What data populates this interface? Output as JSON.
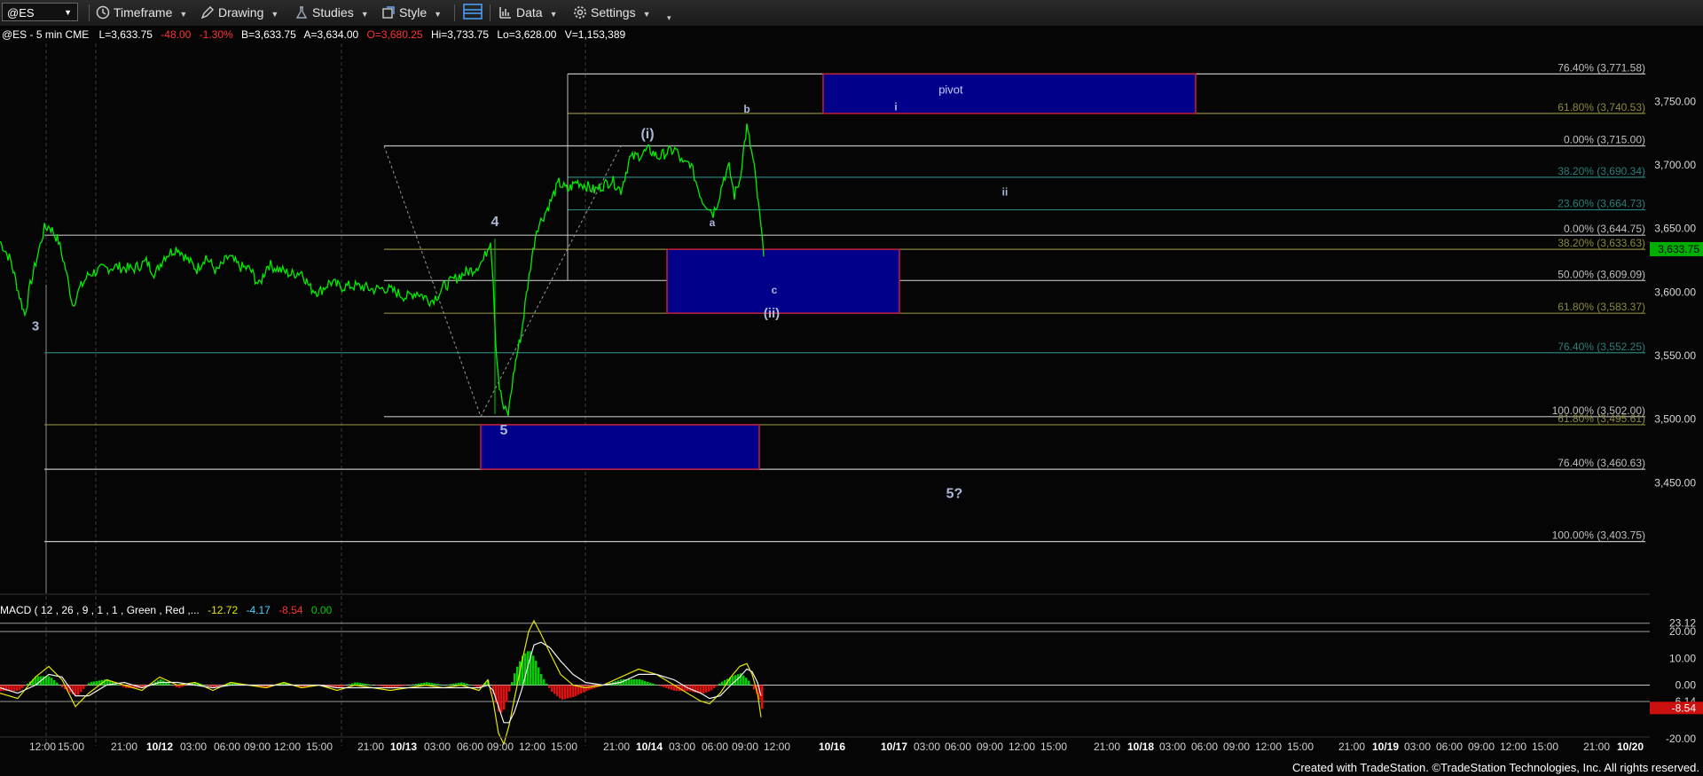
{
  "toolbar": {
    "symbol": "@ES",
    "timeframe": "Timeframe",
    "drawing": "Drawing",
    "studies": "Studies",
    "style": "Style",
    "data": "Data",
    "settings": "Settings"
  },
  "footer": {
    "credit": "Created with TradeStation. ©TradeStation Technologies, Inc. All rights reserved."
  },
  "colors": {
    "price": "#00ee00",
    "box_fill": "#00008b",
    "box_border": "#c0203a",
    "fib_white": "#bfbfbf",
    "fib_olive": "#8c8a3c",
    "fib_teal": "#2a7f7a",
    "label": "#aab8d8"
  },
  "chart_data": {
    "type": "line",
    "header": {
      "symbol_desc": "@ES - 5 min  CME",
      "L": "L=3,633.75",
      "chg": "-48.00",
      "pct": "-1.30%",
      "B": "B=3,633.75",
      "A": "A=3,634.00",
      "O": "O=3,680.25",
      "Hi": "Hi=3,733.75",
      "Lo": "Lo=3,628.00",
      "V": "V=1,153,389"
    },
    "ylim": [
      3370,
      3790
    ],
    "y_ticks": [
      "3,750.00",
      "3,700.00",
      "3,650.00",
      "3,600.00",
      "3,550.00",
      "3,500.00",
      "3,450.00"
    ],
    "y_tick_values": [
      3750,
      3700,
      3650,
      3600,
      3550,
      3500,
      3450
    ],
    "last_price": "3,633.75",
    "x_range": [
      0,
      1860
    ],
    "x_ticks": [
      {
        "t": 48,
        "label": "12:00"
      },
      {
        "t": 80,
        "label": "15:00"
      },
      {
        "t": 140,
        "label": "21:00"
      },
      {
        "t": 180,
        "label": "10/12",
        "bold": true
      },
      {
        "t": 218,
        "label": "03:00"
      },
      {
        "t": 256,
        "label": "06:00"
      },
      {
        "t": 290,
        "label": "09:00"
      },
      {
        "t": 324,
        "label": "12:00"
      },
      {
        "t": 360,
        "label": "15:00"
      },
      {
        "t": 418,
        "label": "21:00"
      },
      {
        "t": 455,
        "label": "10/13",
        "bold": true
      },
      {
        "t": 493,
        "label": "03:00"
      },
      {
        "t": 530,
        "label": "06:00"
      },
      {
        "t": 564,
        "label": "09:00"
      },
      {
        "t": 600,
        "label": "12:00"
      },
      {
        "t": 636,
        "label": "15:00"
      },
      {
        "t": 695,
        "label": "21:00"
      },
      {
        "t": 732,
        "label": "10/14",
        "bold": true
      },
      {
        "t": 769,
        "label": "03:00"
      },
      {
        "t": 806,
        "label": "06:00"
      },
      {
        "t": 840,
        "label": "09:00"
      },
      {
        "t": 876,
        "label": "12:00"
      },
      {
        "t": 938,
        "label": "10/16",
        "bold": true
      },
      {
        "t": 1008,
        "label": "10/17",
        "bold": true
      },
      {
        "t": 1045,
        "label": "03:00"
      },
      {
        "t": 1080,
        "label": "06:00"
      },
      {
        "t": 1116,
        "label": "09:00"
      },
      {
        "t": 1152,
        "label": "12:00"
      },
      {
        "t": 1188,
        "label": "15:00"
      },
      {
        "t": 1248,
        "label": "21:00"
      },
      {
        "t": 1286,
        "label": "10/18",
        "bold": true
      },
      {
        "t": 1322,
        "label": "03:00"
      },
      {
        "t": 1358,
        "label": "06:00"
      },
      {
        "t": 1394,
        "label": "09:00"
      },
      {
        "t": 1430,
        "label": "12:00"
      },
      {
        "t": 1466,
        "label": "15:00"
      },
      {
        "t": 1524,
        "label": "21:00"
      },
      {
        "t": 1562,
        "label": "10/19",
        "bold": true
      },
      {
        "t": 1598,
        "label": "03:00"
      },
      {
        "t": 1634,
        "label": "06:00"
      },
      {
        "t": 1670,
        "label": "09:00"
      },
      {
        "t": 1706,
        "label": "12:00"
      },
      {
        "t": 1742,
        "label": "15:00"
      },
      {
        "t": 1800,
        "label": "21:00"
      },
      {
        "t": 1838,
        "label": "10/20",
        "bold": true
      }
    ],
    "session_lines": [
      52,
      108,
      385,
      660
    ],
    "price_anchors": [
      [
        0,
        3640
      ],
      [
        12,
        3625
      ],
      [
        22,
        3597
      ],
      [
        28,
        3582
      ],
      [
        34,
        3605
      ],
      [
        42,
        3628
      ],
      [
        50,
        3650
      ],
      [
        56,
        3652
      ],
      [
        66,
        3640
      ],
      [
        74,
        3618
      ],
      [
        82,
        3590
      ],
      [
        90,
        3603
      ],
      [
        100,
        3614
      ],
      [
        115,
        3618
      ],
      [
        130,
        3620
      ],
      [
        150,
        3618
      ],
      [
        165,
        3624
      ],
      [
        175,
        3614
      ],
      [
        185,
        3628
      ],
      [
        200,
        3635
      ],
      [
        212,
        3625
      ],
      [
        222,
        3618
      ],
      [
        232,
        3628
      ],
      [
        244,
        3616
      ],
      [
        258,
        3628
      ],
      [
        270,
        3620
      ],
      [
        282,
        3618
      ],
      [
        292,
        3605
      ],
      [
        302,
        3622
      ],
      [
        314,
        3618
      ],
      [
        328,
        3614
      ],
      [
        340,
        3616
      ],
      [
        350,
        3603
      ],
      [
        360,
        3600
      ],
      [
        372,
        3608
      ],
      [
        384,
        3604
      ],
      [
        396,
        3605
      ],
      [
        410,
        3604
      ],
      [
        420,
        3602
      ],
      [
        434,
        3603
      ],
      [
        446,
        3600
      ],
      [
        458,
        3596
      ],
      [
        470,
        3600
      ],
      [
        486,
        3593
      ],
      [
        494,
        3598
      ],
      [
        500,
        3604
      ],
      [
        512,
        3610
      ],
      [
        524,
        3615
      ],
      [
        534,
        3618
      ],
      [
        545,
        3625
      ],
      [
        550,
        3635
      ],
      [
        553,
        3642
      ],
      [
        556,
        3610
      ],
      [
        559,
        3560
      ],
      [
        563,
        3525
      ],
      [
        568,
        3508
      ],
      [
        573,
        3504
      ],
      [
        576,
        3520
      ],
      [
        580,
        3540
      ],
      [
        584,
        3555
      ],
      [
        588,
        3568
      ],
      [
        592,
        3590
      ],
      [
        598,
        3620
      ],
      [
        605,
        3650
      ],
      [
        613,
        3660
      ],
      [
        620,
        3670
      ],
      [
        630,
        3686
      ],
      [
        640,
        3680
      ],
      [
        650,
        3687
      ],
      [
        660,
        3684
      ],
      [
        670,
        3680
      ],
      [
        680,
        3684
      ],
      [
        690,
        3688
      ],
      [
        700,
        3680
      ],
      [
        710,
        3705
      ],
      [
        722,
        3708
      ],
      [
        732,
        3712
      ],
      [
        742,
        3706
      ],
      [
        752,
        3710
      ],
      [
        762,
        3712
      ],
      [
        770,
        3700
      ],
      [
        778,
        3702
      ],
      [
        786,
        3684
      ],
      [
        792,
        3672
      ],
      [
        798,
        3668
      ],
      [
        804,
        3662
      ],
      [
        810,
        3673
      ],
      [
        816,
        3690
      ],
      [
        822,
        3698
      ],
      [
        828,
        3676
      ],
      [
        834,
        3688
      ],
      [
        838,
        3710
      ],
      [
        842,
        3730
      ],
      [
        846,
        3715
      ],
      [
        850,
        3700
      ],
      [
        854,
        3675
      ],
      [
        858,
        3650
      ],
      [
        861,
        3628
      ]
    ],
    "fib_levels": [
      {
        "price": 3771.58,
        "label": "76.40% (3,771.58)",
        "x0": 640,
        "x1": 1855,
        "color": "white"
      },
      {
        "price": 3740.53,
        "label": "61.80% (3,740.53)",
        "x0": 640,
        "x1": 1855,
        "color": "olive"
      },
      {
        "price": 3715.0,
        "label": "0.00% (3,715.00)",
        "x0": 433,
        "x1": 1855,
        "color": "white"
      },
      {
        "price": 3690.34,
        "label": "38.20% (3,690.34)",
        "x0": 640,
        "x1": 1855,
        "color": "teal"
      },
      {
        "price": 3664.73,
        "label": "23.60% (3,664.73)",
        "x0": 640,
        "x1": 1855,
        "color": "teal"
      },
      {
        "price": 3644.75,
        "label": "0.00% (3,644.75)",
        "x0": 50,
        "x1": 1855,
        "color": "white"
      },
      {
        "price": 3633.63,
        "label": "38.20% (3,633.63)",
        "x0": 433,
        "x1": 1855,
        "color": "olive"
      },
      {
        "price": 3609.09,
        "label": "50.00% (3,609.09)",
        "x0": 433,
        "x1": 1855,
        "color": "white"
      },
      {
        "price": 3583.37,
        "label": "61.80% (3,583.37)",
        "x0": 433,
        "x1": 1855,
        "color": "olive"
      },
      {
        "price": 3552.25,
        "label": "76.40% (3,552.25)",
        "x0": 50,
        "x1": 1855,
        "color": "teal"
      },
      {
        "price": 3502.0,
        "label": "100.00% (3,502.00)",
        "x0": 433,
        "x1": 1855,
        "color": "white"
      },
      {
        "price": 3495.61,
        "label": "61.80% (3,495.61)",
        "x0": 50,
        "x1": 1855,
        "color": "olive"
      },
      {
        "price": 3460.63,
        "label": "76.40% (3,460.63)",
        "x0": 50,
        "x1": 1855,
        "color": "white"
      },
      {
        "price": 3403.75,
        "label": "100.00% (3,403.75)",
        "x0": 50,
        "x1": 1855,
        "color": "white"
      }
    ],
    "boxes": [
      {
        "name": "pivot-box",
        "x0": 928,
        "x1": 1348,
        "p_top": 3771.58,
        "p_bot": 3740.53,
        "label": "pivot"
      },
      {
        "name": "wave-ii-target-box",
        "x0": 752,
        "x1": 1014,
        "p_top": 3633.63,
        "p_bot": 3583.37,
        "label": ""
      },
      {
        "name": "wave-5-target-box",
        "x0": 542,
        "x1": 856,
        "p_top": 3495.61,
        "p_bot": 3460.63,
        "label": ""
      }
    ],
    "wave_labels": [
      {
        "text": "3",
        "t": 40,
        "p": 3570,
        "size": 15
      },
      {
        "text": "4",
        "t": 558,
        "p": 3652,
        "size": 16
      },
      {
        "text": "5",
        "t": 568,
        "p": 3488,
        "size": 16
      },
      {
        "text": "(i)",
        "t": 730,
        "p": 3721,
        "size": 16
      },
      {
        "text": "a",
        "t": 803,
        "p": 3652,
        "size": 12
      },
      {
        "text": "b",
        "t": 842,
        "p": 3741,
        "size": 12
      },
      {
        "text": "c",
        "t": 873,
        "p": 3599,
        "size": 12
      },
      {
        "text": "(ii)",
        "t": 870,
        "p": 3580,
        "size": 15
      },
      {
        "text": "i",
        "t": 1010,
        "p": 3743,
        "size": 12
      },
      {
        "text": "ii",
        "t": 1133,
        "p": 3676,
        "size": 12
      },
      {
        "text": "5?",
        "t": 1076,
        "p": 3438,
        "size": 16
      }
    ],
    "trendlines": [
      {
        "t0": 433,
        "p0": 3715.0,
        "t1": 542,
        "p1": 3502.0
      },
      {
        "t0": 542,
        "p0": 3502.0,
        "t1": 700,
        "p1": 3715.0
      }
    ],
    "macd": {
      "title": "MACD ( 12 , 26 , 9 , 1 , 1 , Green , Red ,...",
      "values_text": [
        "-12.72",
        "-4.17",
        "-8.54",
        "0.00"
      ],
      "value_colors": [
        "#e6e600",
        "#4fd0ff",
        "#ff3030",
        "#00cc00"
      ],
      "ylim": [
        -26,
        26
      ],
      "y_ticks": [
        {
          "v": 23.12,
          "label": "23.12"
        },
        {
          "v": 20,
          "label": "20.00"
        },
        {
          "v": 10,
          "label": "10.00"
        },
        {
          "v": 0,
          "label": "0.00"
        },
        {
          "v": -6.14,
          "label": "-6.14"
        },
        {
          "v": -8.54,
          "label": "-8.54"
        },
        {
          "v": -20,
          "label": "-20.00"
        }
      ],
      "h_lines": [
        23.12,
        20,
        0,
        -6.14
      ],
      "line1": [
        [
          0,
          -3
        ],
        [
          20,
          -5
        ],
        [
          40,
          3
        ],
        [
          55,
          7
        ],
        [
          70,
          2
        ],
        [
          85,
          -8
        ],
        [
          100,
          -3
        ],
        [
          120,
          2
        ],
        [
          140,
          0
        ],
        [
          160,
          -2
        ],
        [
          180,
          3
        ],
        [
          200,
          0
        ],
        [
          220,
          1
        ],
        [
          240,
          -2
        ],
        [
          260,
          1
        ],
        [
          280,
          0
        ],
        [
          300,
          -1
        ],
        [
          320,
          1
        ],
        [
          340,
          -1
        ],
        [
          360,
          0
        ],
        [
          380,
          -2
        ],
        [
          400,
          0
        ],
        [
          420,
          -1
        ],
        [
          440,
          -2
        ],
        [
          460,
          -1
        ],
        [
          480,
          0
        ],
        [
          500,
          -1
        ],
        [
          520,
          0
        ],
        [
          540,
          -2
        ],
        [
          550,
          2
        ],
        [
          556,
          -6
        ],
        [
          562,
          -18
        ],
        [
          568,
          -22
        ],
        [
          574,
          -15
        ],
        [
          580,
          -5
        ],
        [
          588,
          8
        ],
        [
          596,
          20
        ],
        [
          602,
          24
        ],
        [
          610,
          19
        ],
        [
          620,
          12
        ],
        [
          632,
          4
        ],
        [
          646,
          0
        ],
        [
          660,
          -1
        ],
        [
          680,
          0
        ],
        [
          700,
          3
        ],
        [
          720,
          6
        ],
        [
          740,
          4
        ],
        [
          760,
          0
        ],
        [
          775,
          -3
        ],
        [
          790,
          -6
        ],
        [
          800,
          -7
        ],
        [
          812,
          -3
        ],
        [
          824,
          3
        ],
        [
          834,
          7
        ],
        [
          842,
          8
        ],
        [
          848,
          4
        ],
        [
          854,
          -3
        ],
        [
          858,
          -12
        ]
      ],
      "line2": [
        [
          0,
          -1
        ],
        [
          20,
          -3
        ],
        [
          40,
          0
        ],
        [
          55,
          4
        ],
        [
          70,
          3
        ],
        [
          85,
          -4
        ],
        [
          100,
          -4
        ],
        [
          120,
          0
        ],
        [
          140,
          1
        ],
        [
          160,
          -1
        ],
        [
          180,
          1
        ],
        [
          200,
          1
        ],
        [
          220,
          0
        ],
        [
          240,
          -1
        ],
        [
          260,
          0
        ],
        [
          280,
          0
        ],
        [
          300,
          0
        ],
        [
          320,
          0
        ],
        [
          340,
          0
        ],
        [
          360,
          0
        ],
        [
          380,
          -1
        ],
        [
          400,
          -1
        ],
        [
          420,
          -1
        ],
        [
          440,
          -1
        ],
        [
          460,
          -1
        ],
        [
          480,
          -1
        ],
        [
          500,
          -1
        ],
        [
          520,
          -1
        ],
        [
          540,
          -1
        ],
        [
          550,
          0
        ],
        [
          556,
          -2
        ],
        [
          562,
          -8
        ],
        [
          568,
          -14
        ],
        [
          574,
          -14
        ],
        [
          580,
          -10
        ],
        [
          588,
          -2
        ],
        [
          596,
          8
        ],
        [
          602,
          15
        ],
        [
          610,
          16
        ],
        [
          620,
          14
        ],
        [
          632,
          9
        ],
        [
          646,
          4
        ],
        [
          660,
          1
        ],
        [
          680,
          0
        ],
        [
          700,
          1
        ],
        [
          720,
          4
        ],
        [
          740,
          4
        ],
        [
          760,
          2
        ],
        [
          775,
          -1
        ],
        [
          790,
          -3
        ],
        [
          800,
          -5
        ],
        [
          812,
          -4
        ],
        [
          824,
          0
        ],
        [
          834,
          3
        ],
        [
          842,
          6
        ],
        [
          848,
          5
        ],
        [
          854,
          1
        ],
        [
          858,
          -4
        ]
      ]
    }
  }
}
